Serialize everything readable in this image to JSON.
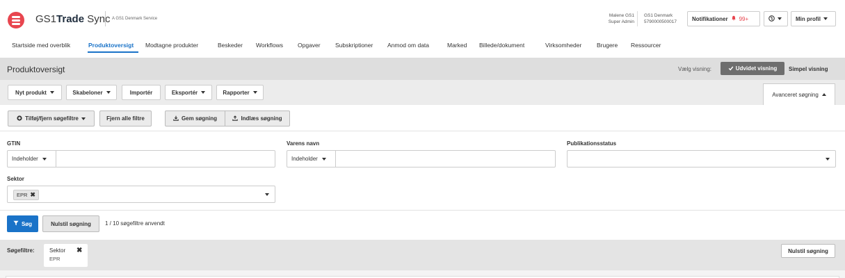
{
  "header": {
    "brand_prefix": "GS1",
    "brand_bold": "Trade",
    "brand_suffix": " Sync",
    "brand_sub": "A GS1 Denmark Service",
    "user_name": "Malene GS1",
    "user_role": "Super Admin",
    "org_name": "GS1 Denmark",
    "org_gln": "5790000500017",
    "notifications_label": "Notifikationer",
    "notifications_count": "99+",
    "profile_label": "Min profil",
    "accent_color": "#e8464f"
  },
  "nav": {
    "items": [
      "Startside med overblik",
      "Produktoversigt",
      "Modtagne produkter",
      "Beskeder",
      "Workflows",
      "Opgaver",
      "Subskriptioner",
      "Anmod om data",
      "Marked",
      "Billede/dokument",
      "Virksomheder",
      "Brugere",
      "Ressourcer"
    ],
    "active": "Produktoversigt",
    "active_color": "#1a73c8"
  },
  "titlebar": {
    "title": "Produktoversigt",
    "view_label": "Vælg visning:",
    "view_extended": "Udvidet visning",
    "view_simple": "Simpel visning"
  },
  "toolbar": {
    "new_product": "Nyt produkt",
    "templates": "Skabeloner",
    "import": "Importér",
    "export": "Eksportér",
    "reports": "Rapporter",
    "advanced_search": "Avanceret søgning"
  },
  "filter_buttons": {
    "add_remove": "Tilføj/fjern søgefiltre",
    "remove_all": "Fjern alle filtre",
    "save_search": "Gem søgning",
    "load_search": "Indlæs søgning"
  },
  "form": {
    "gtin_label": "GTIN",
    "gtin_operator": "Indeholder",
    "gtin_value": "",
    "name_label": "Varens navn",
    "name_operator": "Indeholder",
    "name_value": "",
    "status_label": "Publikationsstatus",
    "status_value": "",
    "sector_label": "Sektor",
    "sector_chip": "EPR"
  },
  "actions": {
    "search": "Søg",
    "reset": "Nulstil søgning",
    "applied": "1 / 10 søgefiltre anvendt"
  },
  "active_filters": {
    "label": "Søgefiltre:",
    "items": [
      {
        "name": "Sektor",
        "value": "EPR"
      }
    ],
    "reset": "Nulstil søgning"
  }
}
